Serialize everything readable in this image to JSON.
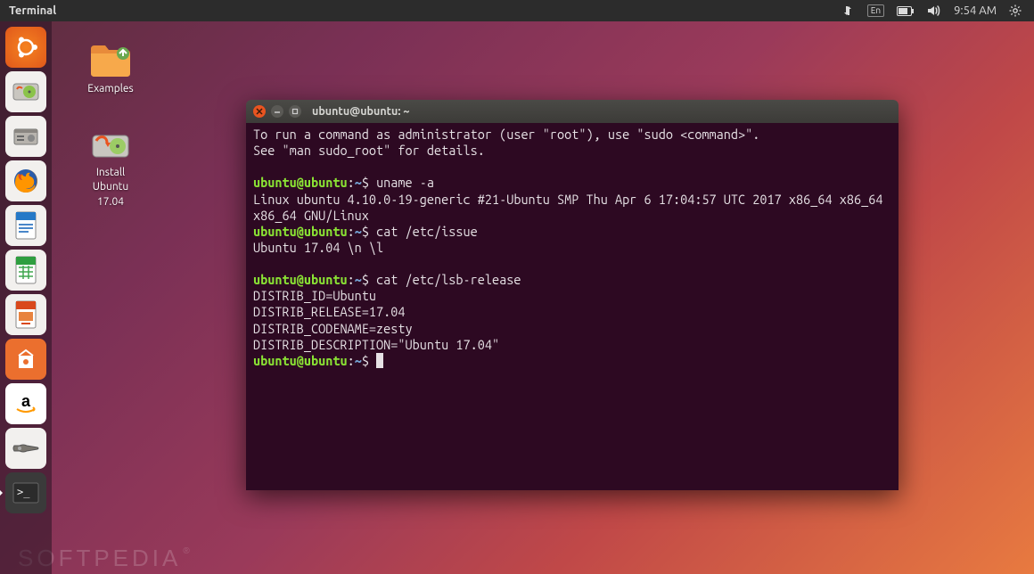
{
  "top_panel": {
    "active_app": "Terminal",
    "lang": "En",
    "time": "9:54 AM"
  },
  "launcher": [
    {
      "name": "ubuntu-dash",
      "label": "Dash"
    },
    {
      "name": "disk-utility",
      "label": "Disk Utility"
    },
    {
      "name": "files",
      "label": "Files"
    },
    {
      "name": "firefox",
      "label": "Firefox"
    },
    {
      "name": "libreoffice-writer",
      "label": "LibreOffice Writer"
    },
    {
      "name": "libreoffice-calc",
      "label": "LibreOffice Calc"
    },
    {
      "name": "libreoffice-impress",
      "label": "LibreOffice Impress"
    },
    {
      "name": "ubuntu-software",
      "label": "Ubuntu Software"
    },
    {
      "name": "amazon",
      "label": "Amazon"
    },
    {
      "name": "system-settings",
      "label": "System Settings"
    },
    {
      "name": "terminal",
      "label": "Terminal"
    }
  ],
  "desktop": {
    "examples": "Examples",
    "install": "Install\nUbuntu\n17.04"
  },
  "terminal": {
    "title": "ubuntu@ubuntu: ~",
    "prompt_user": "ubuntu@ubuntu",
    "prompt_path": "~",
    "line_sudo1": "To run a command as administrator (user \"root\"), use \"sudo <command>\".",
    "line_sudo2": "See \"man sudo_root\" for details.",
    "cmd1": "uname -a",
    "out1": "Linux ubuntu 4.10.0-19-generic #21-Ubuntu SMP Thu Apr 6 17:04:57 UTC 2017 x86_64 x86_64 x86_64 GNU/Linux",
    "cmd2": "cat /etc/issue",
    "out2": "Ubuntu 17.04 \\n \\l",
    "cmd3": "cat /etc/lsb-release",
    "out3a": "DISTRIB_ID=Ubuntu",
    "out3b": "DISTRIB_RELEASE=17.04",
    "out3c": "DISTRIB_CODENAME=zesty",
    "out3d": "DISTRIB_DESCRIPTION=\"Ubuntu 17.04\""
  },
  "watermark": "SOFTPEDIA"
}
